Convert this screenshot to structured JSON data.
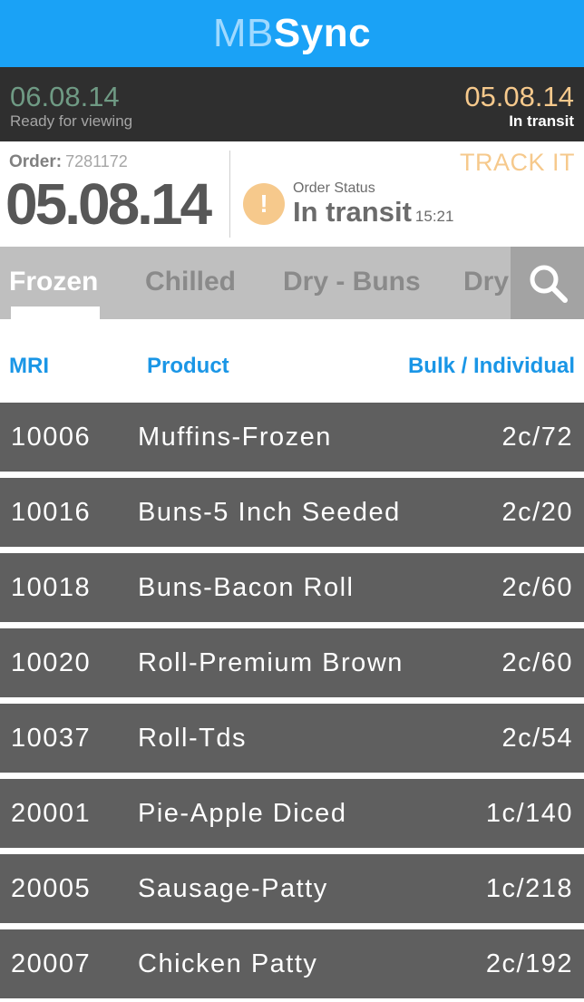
{
  "header": {
    "brand_prefix": "MB",
    "brand_suffix": "Sync"
  },
  "summary": {
    "left_date": "06.08.14",
    "left_status": "Ready for viewing",
    "right_date": "05.08.14",
    "right_status": "In transit"
  },
  "order": {
    "label": "Order:",
    "number": "7281172",
    "date": "05.08.14",
    "track_label": "TRACK IT",
    "status_icon": "!",
    "status_label": "Order Status",
    "status_value": "In transit",
    "status_time": "15:21"
  },
  "tabs": [
    "Frozen",
    "Chilled",
    "Dry - Buns",
    "Dry"
  ],
  "columns": {
    "mri": "MRI",
    "product": "Product",
    "qty": "Bulk / Individual"
  },
  "items": [
    {
      "mri": "10006",
      "product": "Muffins-Frozen",
      "qty": "2c/72"
    },
    {
      "mri": "10016",
      "product": "Buns-5 Inch Seeded",
      "qty": "2c/20"
    },
    {
      "mri": "10018",
      "product": "Buns-Bacon Roll",
      "qty": "2c/60"
    },
    {
      "mri": "10020",
      "product": "Roll-Premium Brown",
      "qty": "2c/60"
    },
    {
      "mri": "10037",
      "product": "Roll-Tds",
      "qty": "2c/54"
    },
    {
      "mri": "20001",
      "product": "Pie-Apple Diced",
      "qty": "1c/140"
    },
    {
      "mri": "20005",
      "product": "Sausage-Patty",
      "qty": "1c/218"
    },
    {
      "mri": "20007",
      "product": "Chicken Patty",
      "qty": "2c/192"
    }
  ],
  "colors": {
    "header_blue": "#1aa2f6",
    "ready_green": "#6f9a84",
    "transit_orange": "#f6c98c",
    "column_blue": "#1a96e6",
    "row_gray": "#5f5f5f"
  }
}
